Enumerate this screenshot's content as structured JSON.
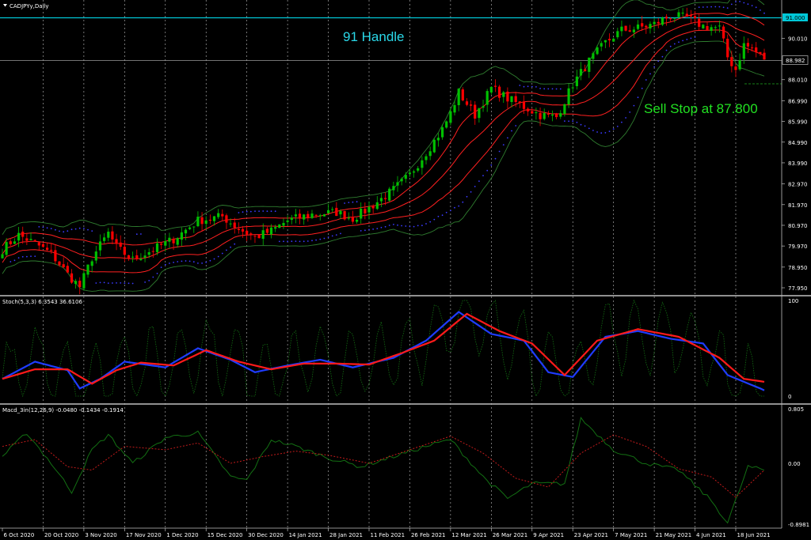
{
  "window": {
    "title": "CADJPYy,Daily"
  },
  "colors": {
    "background": "#000000",
    "bull_candle": "#00c000",
    "bear_candle": "#ff0000",
    "bands_outer": "#2f7d2f",
    "bands_red": "#ff2020",
    "psar": "#3a3aff",
    "hline_cyan": "#00c8d8",
    "price_line": "#9a9a9a",
    "stoch_main": "#1f3cff",
    "stoch_signal": "#ff1a1a",
    "stoch_k_raw": "#137013",
    "macd_main": "#137013",
    "macd_signal": "#c01a1a",
    "grid_vertical": "#bfbfbf",
    "panel_separator": "#bfbfbf",
    "price_tag_cyan": "#00c8d8",
    "annotation_cyan": "#2ad8e8",
    "annotation_green": "#22e022"
  },
  "annotations": {
    "handle_text": "91 Handle",
    "stop_text": "Sell Stop at 87.800"
  },
  "price_tags": {
    "resistance": "91.000",
    "current": "88.982"
  },
  "stoch_header": "Stoch(5,3,3) 6.3543 36.6106",
  "macd_header": "Macd_3in(12,26,9) -0.0480 -0.1434 -0.1914",
  "chart_data": [
    {
      "type": "candlestick",
      "title": "CADJPYy,Daily",
      "y_ticks": [
        "91.000",
        "90.010",
        "88.982",
        "88.010",
        "86.990",
        "85.990",
        "84.990",
        "83.990",
        "82.970",
        "81.970",
        "80.970",
        "79.970",
        "78.950",
        "77.950"
      ],
      "ylim": [
        77.3,
        91.75
      ],
      "resistance_level": 91.0,
      "current_price": 88.982,
      "sell_stop": 87.8,
      "x_dates": [
        "6 Oct 2020",
        "20 Oct 2020",
        "3 Nov 2020",
        "17 Nov 2020",
        "1 Dec 2020",
        "15 Dec 2020",
        "30 Dec 2020",
        "14 Jan 2021",
        "28 Jan 2021",
        "11 Feb 2021",
        "26 Feb 2021",
        "12 Mar 2021",
        "26 Mar 2021",
        "9 Apr 2021",
        "23 Apr 2021",
        "7 May 2021",
        "21 May 2021",
        "4 Jun 2021",
        "18 Jun 2021"
      ],
      "close_path_anchors": [
        [
          0,
          79.8
        ],
        [
          4,
          80.5
        ],
        [
          8,
          80.1
        ],
        [
          12,
          79.6
        ],
        [
          16,
          78.6
        ],
        [
          19,
          78.0
        ],
        [
          22,
          79.4
        ],
        [
          26,
          80.6
        ],
        [
          28,
          79.9
        ],
        [
          32,
          79.3
        ],
        [
          36,
          79.7
        ],
        [
          42,
          80.3
        ],
        [
          48,
          81.2
        ],
        [
          54,
          81.4
        ],
        [
          58,
          80.8
        ],
        [
          62,
          80.4
        ],
        [
          66,
          80.7
        ],
        [
          70,
          81.2
        ],
        [
          76,
          81.5
        ],
        [
          82,
          81.6
        ],
        [
          86,
          81.3
        ],
        [
          90,
          81.8
        ],
        [
          96,
          82.7
        ],
        [
          100,
          83.4
        ],
        [
          104,
          84.5
        ],
        [
          108,
          85.6
        ],
        [
          110,
          86.4
        ],
        [
          112,
          87.4
        ],
        [
          116,
          86.3
        ],
        [
          120,
          87.6
        ],
        [
          124,
          87.1
        ],
        [
          128,
          86.7
        ],
        [
          132,
          86.3
        ],
        [
          136,
          86.2
        ],
        [
          140,
          87.8
        ],
        [
          144,
          88.9
        ],
        [
          148,
          89.8
        ],
        [
          152,
          90.4
        ],
        [
          156,
          90.5
        ],
        [
          160,
          90.7
        ],
        [
          164,
          91.1
        ],
        [
          168,
          91.0
        ],
        [
          172,
          90.6
        ],
        [
          176,
          90.5
        ],
        [
          178,
          89.1
        ],
        [
          180,
          88.5
        ],
        [
          182,
          89.7
        ],
        [
          184,
          89.5
        ],
        [
          187,
          88.982
        ]
      ],
      "series": [
        {
          "name": "Bollinger outer bands"
        },
        {
          "name": "Envelope / middle bands"
        },
        {
          "name": "Parabolic SAR"
        }
      ]
    },
    {
      "type": "line",
      "title": "Stoch(5,3,3) 6.3543 36.6106",
      "ylim": [
        0,
        100
      ],
      "y_ticks": [
        "100",
        "0"
      ],
      "main_anchors": [
        [
          0,
          18
        ],
        [
          8,
          36
        ],
        [
          16,
          27
        ],
        [
          19,
          8
        ],
        [
          24,
          18
        ],
        [
          30,
          36
        ],
        [
          40,
          30
        ],
        [
          48,
          50
        ],
        [
          56,
          38
        ],
        [
          62,
          25
        ],
        [
          70,
          32
        ],
        [
          78,
          38
        ],
        [
          86,
          30
        ],
        [
          96,
          40
        ],
        [
          104,
          58
        ],
        [
          112,
          88
        ],
        [
          120,
          65
        ],
        [
          128,
          58
        ],
        [
          134,
          25
        ],
        [
          140,
          20
        ],
        [
          148,
          62
        ],
        [
          156,
          68
        ],
        [
          164,
          60
        ],
        [
          172,
          55
        ],
        [
          178,
          22
        ],
        [
          182,
          15
        ],
        [
          186,
          8
        ],
        [
          187,
          6
        ]
      ],
      "signal_anchors": [
        [
          0,
          18
        ],
        [
          8,
          28
        ],
        [
          16,
          28
        ],
        [
          22,
          13
        ],
        [
          28,
          27
        ],
        [
          34,
          35
        ],
        [
          42,
          32
        ],
        [
          50,
          48
        ],
        [
          58,
          36
        ],
        [
          66,
          28
        ],
        [
          74,
          34
        ],
        [
          82,
          34
        ],
        [
          90,
          33
        ],
        [
          98,
          45
        ],
        [
          106,
          58
        ],
        [
          114,
          86
        ],
        [
          122,
          68
        ],
        [
          130,
          55
        ],
        [
          138,
          22
        ],
        [
          146,
          58
        ],
        [
          156,
          70
        ],
        [
          166,
          62
        ],
        [
          176,
          40
        ],
        [
          182,
          18
        ],
        [
          187,
          15
        ]
      ]
    },
    {
      "type": "line",
      "title": "Macd_3in(12,26,9) -0.0480 -0.1434 -0.1914",
      "y_ticks": [
        "0.805",
        "0.00",
        "-0.8981"
      ],
      "ylim": [
        -0.8981,
        0.805
      ],
      "main_anchors": [
        [
          0,
          0.1
        ],
        [
          6,
          0.45
        ],
        [
          12,
          0.0
        ],
        [
          17,
          -0.42
        ],
        [
          22,
          0.2
        ],
        [
          26,
          0.42
        ],
        [
          32,
          0.0
        ],
        [
          40,
          0.38
        ],
        [
          48,
          0.45
        ],
        [
          56,
          -0.2
        ],
        [
          60,
          -0.25
        ],
        [
          66,
          0.35
        ],
        [
          72,
          0.25
        ],
        [
          80,
          0.08
        ],
        [
          88,
          -0.05
        ],
        [
          96,
          0.1
        ],
        [
          104,
          0.25
        ],
        [
          110,
          0.35
        ],
        [
          118,
          -0.2
        ],
        [
          124,
          -0.52
        ],
        [
          130,
          -0.3
        ],
        [
          138,
          -0.3
        ],
        [
          142,
          0.66
        ],
        [
          150,
          0.2
        ],
        [
          158,
          0.0
        ],
        [
          166,
          -0.1
        ],
        [
          174,
          -0.55
        ],
        [
          178,
          -0.88
        ],
        [
          183,
          -0.05
        ],
        [
          187,
          -0.1
        ]
      ],
      "signal_anchors": [
        [
          0,
          0.25
        ],
        [
          8,
          0.35
        ],
        [
          16,
          -0.05
        ],
        [
          22,
          -0.1
        ],
        [
          30,
          0.25
        ],
        [
          40,
          0.2
        ],
        [
          48,
          0.3
        ],
        [
          56,
          0.0
        ],
        [
          64,
          0.1
        ],
        [
          72,
          0.18
        ],
        [
          80,
          0.12
        ],
        [
          90,
          0.0
        ],
        [
          100,
          0.2
        ],
        [
          110,
          0.4
        ],
        [
          118,
          0.15
        ],
        [
          126,
          -0.22
        ],
        [
          134,
          -0.35
        ],
        [
          142,
          0.15
        ],
        [
          150,
          0.42
        ],
        [
          158,
          0.25
        ],
        [
          166,
          -0.08
        ],
        [
          174,
          -0.2
        ],
        [
          180,
          -0.5
        ],
        [
          187,
          -0.1
        ]
      ]
    }
  ]
}
